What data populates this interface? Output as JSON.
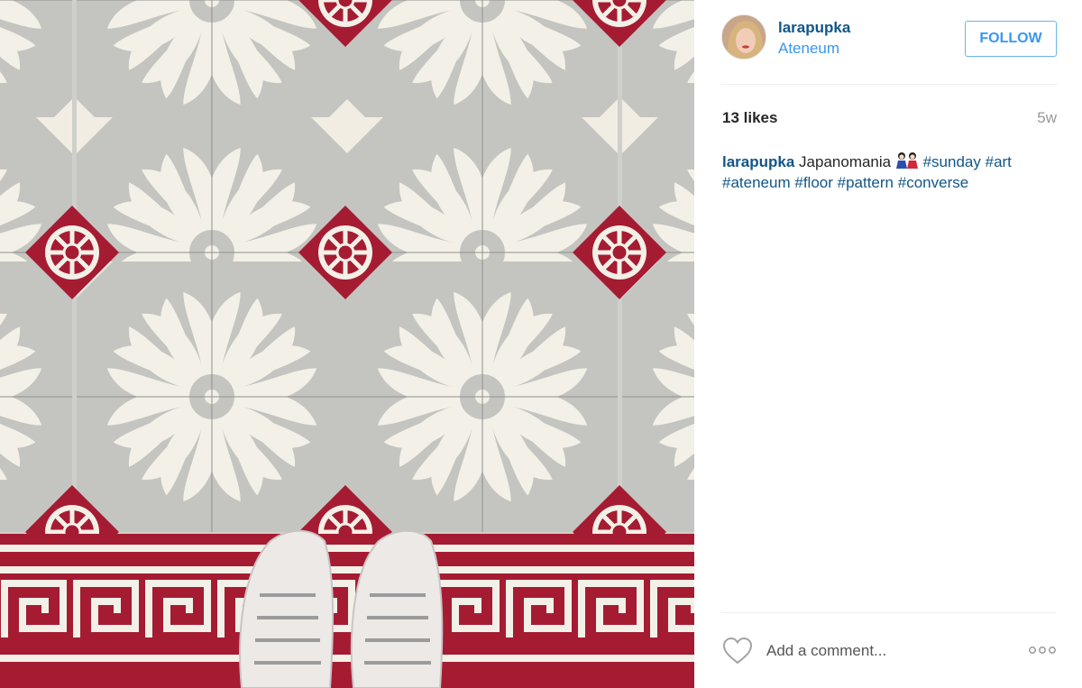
{
  "post": {
    "username": "larapupka",
    "location": "Ateneum",
    "follow_label": "FOLLOW",
    "likes": "13 likes",
    "time_ago": "5w",
    "caption": {
      "user": "larapupka",
      "text": "Japanomania",
      "emoji": "japanese-dolls-emoji",
      "hashtags": [
        "#sunday",
        "#art",
        "#ateneum",
        "#floor",
        "#pattern",
        "#converse"
      ]
    },
    "comment_placeholder": "Add a comment..."
  },
  "icons": {
    "like": "heart-icon",
    "more": "more-options-icon"
  },
  "colors": {
    "link_dark": "#125688",
    "link_light": "#3897f0",
    "muted": "#999999",
    "tile_red": "#a51c32",
    "tile_grey": "#c5c6c1",
    "tile_cream": "#f3f0e7"
  }
}
